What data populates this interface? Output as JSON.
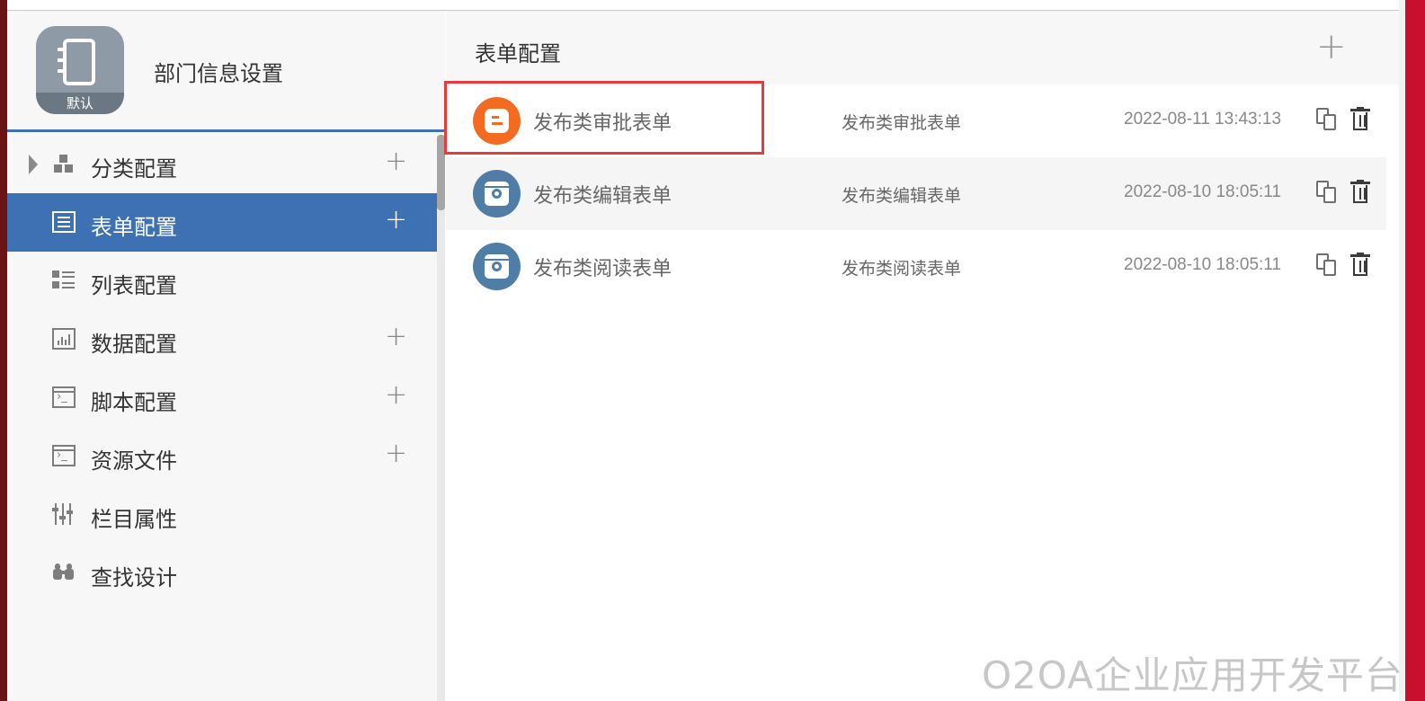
{
  "app": {
    "title": "部门信息设置",
    "icon_name": "notebook-icon",
    "icon_badge": "默认"
  },
  "sidebar": {
    "items": [
      {
        "label": "分类配置",
        "icon": "category-icon",
        "has_add": true,
        "has_caret": true
      },
      {
        "label": "表单配置",
        "icon": "form-icon",
        "has_add": true,
        "active": true
      },
      {
        "label": "列表配置",
        "icon": "list-icon",
        "has_add": false
      },
      {
        "label": "数据配置",
        "icon": "data-chart-icon",
        "has_add": true
      },
      {
        "label": "脚本配置",
        "icon": "script-icon",
        "has_add": true
      },
      {
        "label": "资源文件",
        "icon": "resource-icon",
        "has_add": true
      },
      {
        "label": "栏目属性",
        "icon": "column-settings-icon",
        "has_add": false
      },
      {
        "label": "查找设计",
        "icon": "binoculars-icon",
        "has_add": false
      }
    ],
    "add_symbol": "+"
  },
  "main": {
    "title": "表单配置",
    "add_symbol": "+",
    "rows": [
      {
        "name": "发布类审批表单",
        "alias": "发布类审批表单",
        "time": "2022-08-11 13:43:13",
        "icon": "blogger-icon",
        "selected": true
      },
      {
        "name": "发布类编辑表单",
        "alias": "发布类编辑表单",
        "time": "2022-08-10 18:05:11",
        "icon": "camera-icon"
      },
      {
        "name": "发布类阅读表单",
        "alias": "发布类阅读表单",
        "time": "2022-08-10 18:05:11",
        "icon": "camera-icon"
      }
    ]
  },
  "watermark": "O2OA企业应用开发平台",
  "colors": {
    "accent": "#3d71b3",
    "selection": "#e43c3f",
    "orange_avatar": "#f36b21",
    "blue_avatar": "#4f7da6"
  }
}
